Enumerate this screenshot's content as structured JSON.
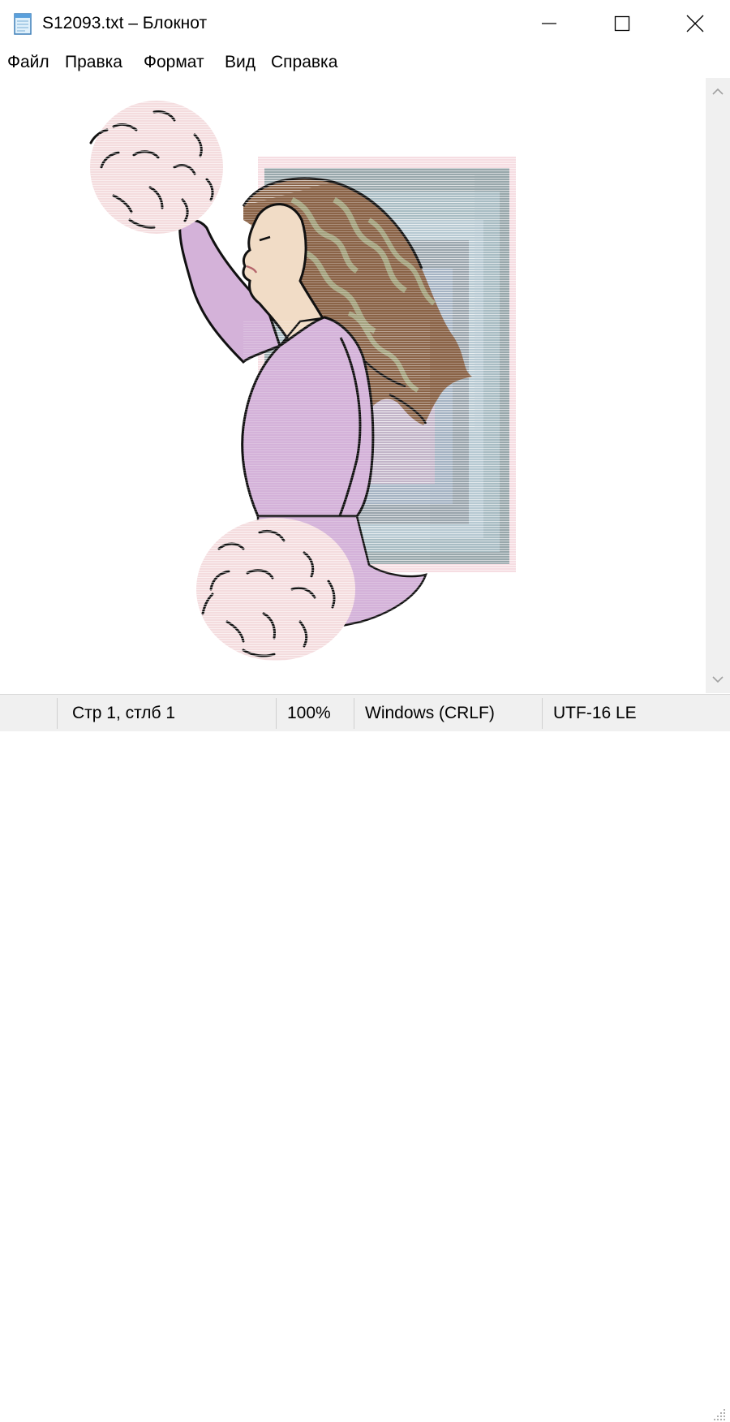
{
  "window": {
    "title": "S12093.txt – Блокнот",
    "app_icon": "notepad-icon",
    "controls": {
      "minimize": "minimize-icon",
      "maximize": "maximize-icon",
      "close": "close-icon"
    }
  },
  "menu": {
    "items": [
      {
        "label": "Файл"
      },
      {
        "label": "Правка"
      },
      {
        "label": "Формат"
      },
      {
        "label": "Вид"
      },
      {
        "label": "Справка"
      }
    ]
  },
  "editor": {
    "content_icon": "cheerleader-ascii-art",
    "colors": {
      "hair": "#8a6347",
      "hair_highlight": "#a4a27e",
      "sweater": "#d4b2d9",
      "skin": "#f1dcc6",
      "pom_pom": "#f4dcde",
      "panel_outer": "#9aa8ad",
      "panel_inner": "#b4c6d0",
      "outline": "#111111"
    }
  },
  "scrollbar": {
    "up_icon": "scroll-up-arrow-icon",
    "down_icon": "scroll-down-arrow-icon"
  },
  "status": {
    "position": "Стр 1, стлб 1",
    "zoom": "100%",
    "line_endings": "Windows (CRLF)",
    "encoding": "UTF-16 LE",
    "grip_icon": "resize-grip-icon"
  }
}
